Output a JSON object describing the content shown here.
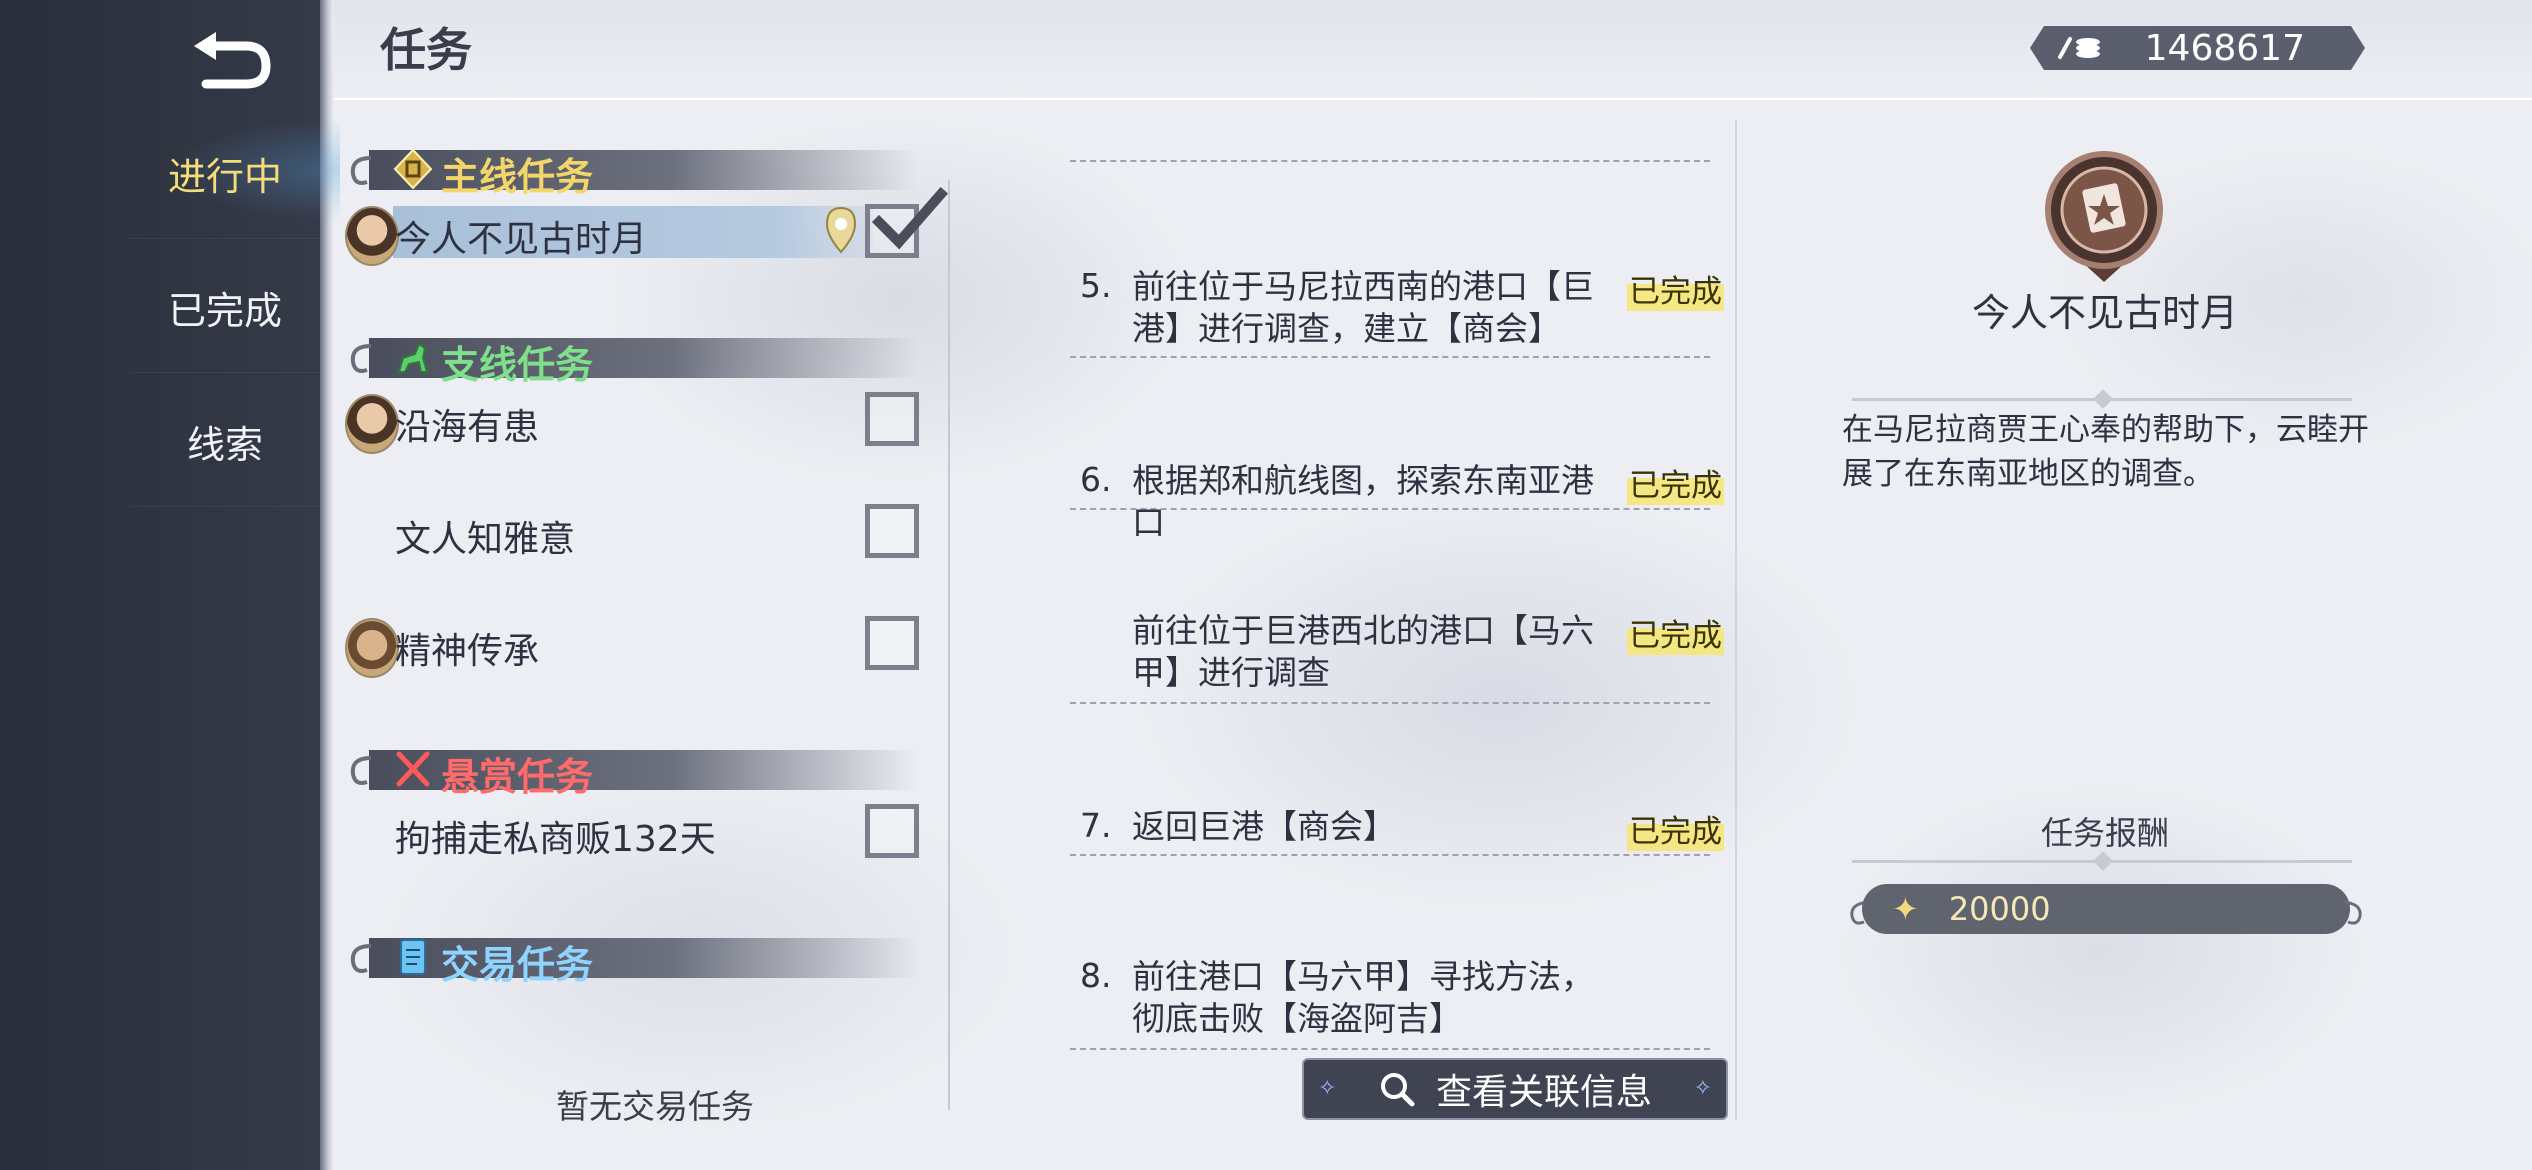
{
  "header": {
    "title": "任务",
    "currency_value": "1468617"
  },
  "sidebar": {
    "items": [
      {
        "label": "进行中",
        "active": true
      },
      {
        "label": "已完成",
        "active": false
      },
      {
        "label": "线索",
        "active": false
      }
    ]
  },
  "categories": {
    "main": {
      "label": "主线任务",
      "color": "#f2d66a"
    },
    "side": {
      "label": "支线任务",
      "color": "#7fe08b"
    },
    "bounty": {
      "label": "悬赏任务",
      "color": "#ff6a6a"
    },
    "trade": {
      "label": "交易任务",
      "color": "#8fd3ff"
    }
  },
  "quests": {
    "main": [
      {
        "name": "今人不见古时月",
        "selected": true,
        "checked": true
      }
    ],
    "side": [
      {
        "name": "沿海有患",
        "checked": false
      },
      {
        "name": "文人知雅意",
        "checked": false
      },
      {
        "name": "精神传承",
        "checked": false
      }
    ],
    "bounty": [
      {
        "name": "拘捕走私商贩132天",
        "checked": false
      }
    ],
    "trade_empty": "暂无交易任务"
  },
  "steps": [
    {
      "num": "5.",
      "desc": "前往位于马尼拉西南的港口【巨港】进行调查，建立【商会】",
      "status": "已完成"
    },
    {
      "num": "6.",
      "desc": "根据郑和航线图，探索东南亚港口",
      "status": "已完成"
    },
    {
      "num": "",
      "desc": "前往位于巨港西北的港口【马六甲】进行调查",
      "status": "已完成"
    },
    {
      "num": "7.",
      "desc": "返回巨港【商会】",
      "status": "已完成"
    },
    {
      "num": "8.",
      "desc": "前往港口【马六甲】寻找方法，彻底击败【海盗阿吉】",
      "status": ""
    }
  ],
  "related_button": "查看关联信息",
  "detail": {
    "title": "今人不见古时月",
    "description": "在马尼拉商贾王心奉的帮助下，云睦开展了在东南亚地区的调查。",
    "reward_heading": "任务报酬",
    "reward_value": "20000"
  }
}
